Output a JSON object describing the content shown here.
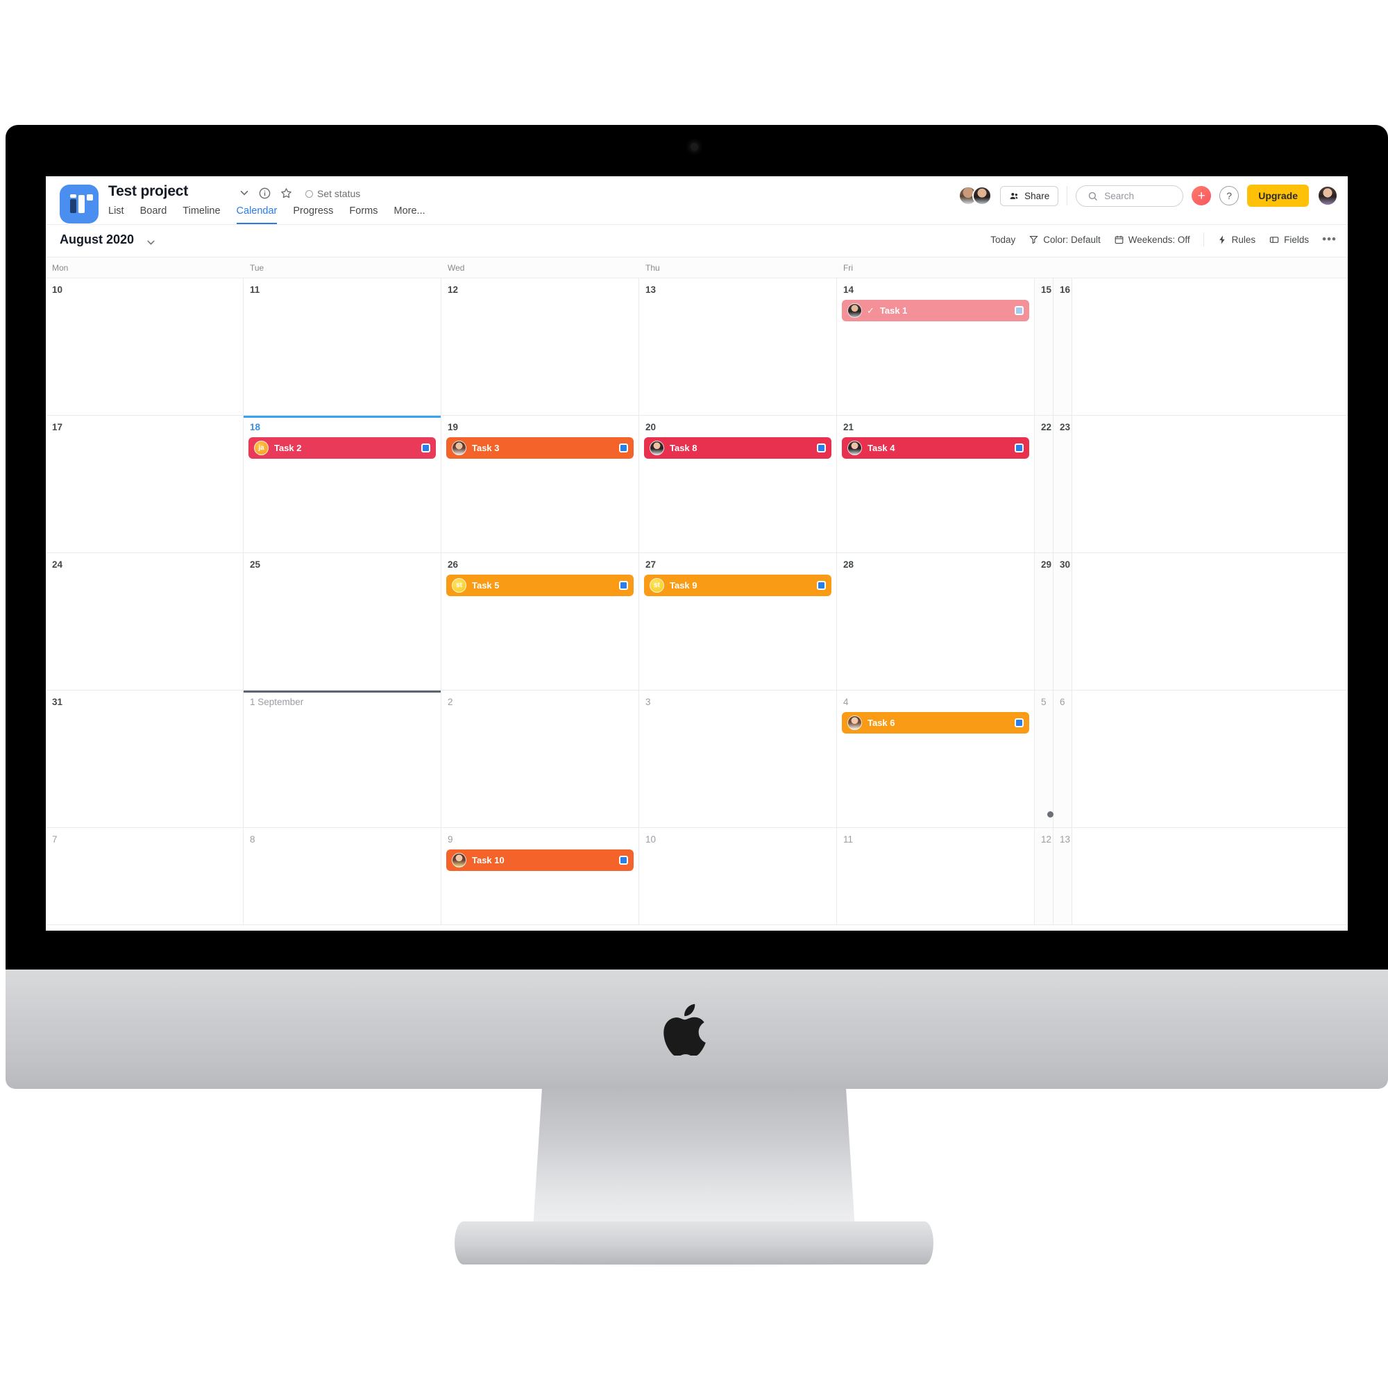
{
  "app": {
    "logo_icon": "asana-logo-icon",
    "project_title": "Test project",
    "set_status_label": "Set status",
    "tabs": [
      {
        "label": "List",
        "active": false
      },
      {
        "label": "Board",
        "active": false
      },
      {
        "label": "Timeline",
        "active": false
      },
      {
        "label": "Calendar",
        "active": true
      },
      {
        "label": "Progress",
        "active": false
      },
      {
        "label": "Forms",
        "active": false
      },
      {
        "label": "More...",
        "active": false
      }
    ],
    "share_label": "Share",
    "search_placeholder": "Search",
    "search_value": "",
    "plus_label": "+",
    "help_label": "?",
    "upgrade_label": "Upgrade"
  },
  "toolbar": {
    "month": "August 2020",
    "today_label": "Today",
    "color_label": "Color: Default",
    "weekends_label": "Weekends: Off",
    "rules_label": "Rules",
    "fields_label": "Fields",
    "more_label": "•••"
  },
  "calendar": {
    "day_headers": [
      "Mon",
      "Tue",
      "Wed",
      "Thu",
      "Fri"
    ],
    "weeks": [
      {
        "cells": [
          {
            "num": "10",
            "weekend": false,
            "muted": false,
            "today": false
          },
          {
            "num": "11",
            "weekend": false,
            "muted": false,
            "today": false
          },
          {
            "num": "12",
            "weekend": false,
            "muted": false,
            "today": false
          },
          {
            "num": "13",
            "weekend": false,
            "muted": false,
            "today": false
          },
          {
            "num": "14",
            "weekend": false,
            "muted": false,
            "today": false,
            "task": {
              "title": "Task 1",
              "color": "#f49097",
              "completed": true,
              "avatar_type": "photo",
              "avatar_face": "face-a",
              "checkbox_color": "#a7c8ef"
            }
          },
          {
            "num": "15",
            "weekend": true,
            "muted": false,
            "today": false
          },
          {
            "num": "16",
            "weekend": true,
            "muted": false,
            "today": false
          }
        ]
      },
      {
        "cells": [
          {
            "num": "17",
            "weekend": false,
            "muted": false,
            "today": false
          },
          {
            "num": "18",
            "weekend": false,
            "muted": false,
            "today": true,
            "task": {
              "title": "Task 2",
              "color": "#ea3a5a",
              "completed": false,
              "avatar_type": "initials",
              "avatar_initials": "ja",
              "avatar_bg": "ini-orange",
              "checkbox_color": "#2a7ee8"
            }
          },
          {
            "num": "19",
            "weekend": false,
            "muted": false,
            "today": false,
            "task": {
              "title": "Task 3",
              "color": "#f4632a",
              "completed": false,
              "avatar_type": "photo",
              "avatar_face": "face-b",
              "checkbox_color": "#2a7ee8"
            }
          },
          {
            "num": "20",
            "weekend": false,
            "muted": false,
            "today": false,
            "task": {
              "title": "Task 8",
              "color": "#e8304f",
              "completed": false,
              "avatar_type": "photo",
              "avatar_face": "face-c",
              "checkbox_color": "#2a7ee8"
            }
          },
          {
            "num": "21",
            "weekend": false,
            "muted": false,
            "today": false,
            "task": {
              "title": "Task 4",
              "color": "#e8304f",
              "completed": false,
              "avatar_type": "photo",
              "avatar_face": "face-c",
              "checkbox_color": "#2a7ee8"
            }
          },
          {
            "num": "22",
            "weekend": true,
            "muted": false,
            "today": false
          },
          {
            "num": "23",
            "weekend": true,
            "muted": false,
            "today": false
          }
        ]
      },
      {
        "cells": [
          {
            "num": "24",
            "weekend": false,
            "muted": false,
            "today": false
          },
          {
            "num": "25",
            "weekend": false,
            "muted": false,
            "today": false
          },
          {
            "num": "26",
            "weekend": false,
            "muted": false,
            "today": false,
            "task": {
              "title": "Task 5",
              "color": "#f99b14",
              "completed": false,
              "avatar_type": "initials",
              "avatar_initials": "st",
              "avatar_bg": "ini-yellow",
              "checkbox_color": "#2a7ee8"
            }
          },
          {
            "num": "27",
            "weekend": false,
            "muted": false,
            "today": false,
            "task": {
              "title": "Task 9",
              "color": "#f99b14",
              "completed": false,
              "avatar_type": "initials",
              "avatar_initials": "st",
              "avatar_bg": "ini-yellow",
              "checkbox_color": "#2a7ee8"
            }
          },
          {
            "num": "28",
            "weekend": false,
            "muted": false,
            "today": false
          },
          {
            "num": "29",
            "weekend": true,
            "muted": false,
            "today": false
          },
          {
            "num": "30",
            "weekend": true,
            "muted": false,
            "today": false
          }
        ]
      },
      {
        "cells": [
          {
            "num": "31",
            "weekend": false,
            "muted": false,
            "today": false
          },
          {
            "num": "1 September",
            "weekend": false,
            "muted": true,
            "today": false,
            "month_start": true
          },
          {
            "num": "2",
            "weekend": false,
            "muted": true,
            "today": false
          },
          {
            "num": "3",
            "weekend": false,
            "muted": true,
            "today": false
          },
          {
            "num": "4",
            "weekend": false,
            "muted": true,
            "today": false,
            "task": {
              "title": "Task 6",
              "color": "#f99b14",
              "completed": false,
              "avatar_type": "photo",
              "avatar_face": "face-d",
              "checkbox_color": "#2a7ee8"
            }
          },
          {
            "num": "5",
            "weekend": true,
            "muted": true,
            "today": false,
            "more_dot": true
          },
          {
            "num": "6",
            "weekend": true,
            "muted": true,
            "today": false
          }
        ]
      },
      {
        "cells": [
          {
            "num": "7",
            "weekend": false,
            "muted": true,
            "today": false
          },
          {
            "num": "8",
            "weekend": false,
            "muted": true,
            "today": false
          },
          {
            "num": "9",
            "weekend": false,
            "muted": true,
            "today": false,
            "task": {
              "title": "Task 10",
              "color": "#f4632a",
              "completed": false,
              "avatar_type": "photo",
              "avatar_face": "face-e",
              "checkbox_color": "#2a7ee8"
            }
          },
          {
            "num": "10",
            "weekend": false,
            "muted": true,
            "today": false
          },
          {
            "num": "11",
            "weekend": false,
            "muted": true,
            "today": false
          },
          {
            "num": "12",
            "weekend": true,
            "muted": true,
            "today": false
          },
          {
            "num": "13",
            "weekend": true,
            "muted": true,
            "today": false
          }
        ]
      }
    ]
  },
  "device": {
    "brand_icon": "apple-logo-icon",
    "webcam_icon": "webcam-icon"
  }
}
